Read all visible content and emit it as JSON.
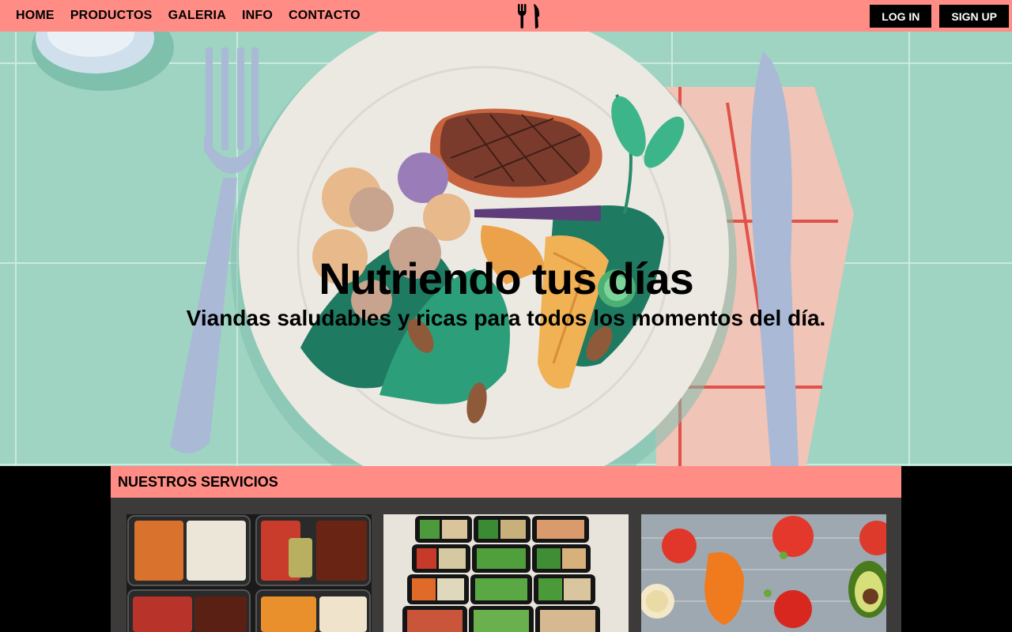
{
  "nav": {
    "links": [
      "HOME",
      "PRODUCTOS",
      "GALERIA",
      "INFO",
      "CONTACTO"
    ],
    "login_label": "LOG IN",
    "signup_label": "SIGN UP",
    "logo_icon": "fork-knife-icon"
  },
  "hero": {
    "title": "Nutriendo tus días",
    "subtitle": "Viandas saludables y ricas para todos los momentos del día."
  },
  "services": {
    "title": "NUESTROS SERVICIOS"
  },
  "colors": {
    "accent": "#ff8c85",
    "hero_bg": "#9fd4c3",
    "section_bg": "#3d3a3a",
    "page_bg": "#000000"
  }
}
